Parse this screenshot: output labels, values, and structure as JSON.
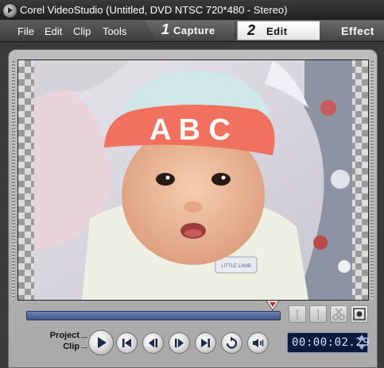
{
  "window": {
    "title": "Corel VideoStudio (Untitled, DVD NTSC 720*480 - Stereo)"
  },
  "menu": {
    "items": [
      {
        "label": "File"
      },
      {
        "label": "Edit"
      },
      {
        "label": "Clip"
      },
      {
        "label": "Tools"
      }
    ]
  },
  "steps": {
    "capture": {
      "num": "1",
      "label": "Capture"
    },
    "edit": {
      "num": "2",
      "label": "Edit",
      "active": true
    },
    "effect": {
      "label": "Effect"
    }
  },
  "preview": {
    "cap_text": "A B C",
    "shirt_text": "LITTLE LAMB"
  },
  "scrub": {
    "mark_in_icon": "mark-in-icon",
    "mark_out_icon": "mark-out-icon",
    "split_icon": "scissors-icon",
    "fullscreen_icon": "fullscreen-icon"
  },
  "playback": {
    "project_label": "Project",
    "clip_label": "Clip",
    "timecode": "00:00:02.29",
    "controls": [
      "play-icon",
      "home-icon",
      "previous-frame-icon",
      "next-frame-icon",
      "end-icon",
      "repeat-icon",
      "volume-icon"
    ]
  },
  "colors": {
    "accent_blue": "#3c5488",
    "timecode_bg": "#0a1a3c"
  }
}
